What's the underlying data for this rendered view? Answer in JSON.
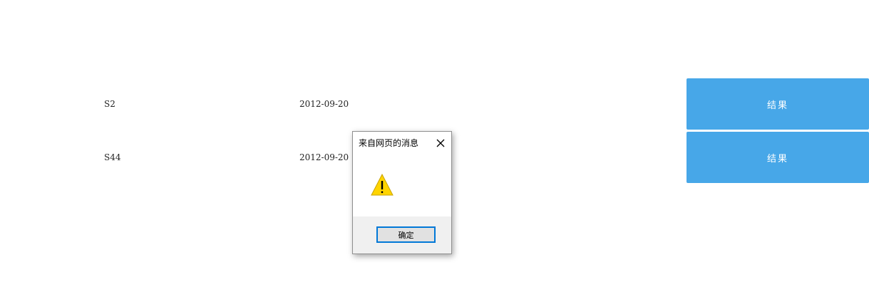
{
  "rows": [
    {
      "id": "S2",
      "date": "2012-09-20",
      "action_label": "结果"
    },
    {
      "id": "S44",
      "date": "2012-09-20",
      "action_label": "结果"
    }
  ],
  "dialog": {
    "title": "来自网页的消息",
    "icon": "warning-icon",
    "ok_label": "确定"
  },
  "colors": {
    "result_button": "#47a7e8",
    "ok_button_border": "#0078d7",
    "warning_fill": "#ffd400"
  }
}
